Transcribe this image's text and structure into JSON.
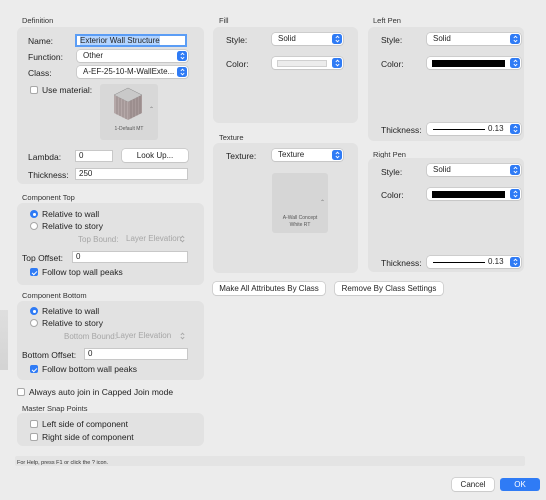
{
  "definition": {
    "title": "Definition",
    "name_label": "Name:",
    "name_value": "Exterior Wall Structure",
    "function_label": "Function:",
    "function_value": "Other",
    "class_label": "Class:",
    "class_value": "A-EF-25-10-M-WallExte...",
    "use_material_label": "Use material:",
    "use_material_checked": false,
    "material_name": "1-Default MT",
    "lambda_label": "Lambda:",
    "lambda_value": "0",
    "lookup_label": "Look Up...",
    "thickness_label": "Thickness:",
    "thickness_value": "250"
  },
  "component_top": {
    "title": "Component Top",
    "relative_wall": "Relative to wall",
    "relative_story": "Relative to story",
    "selected": "Relative to wall",
    "bound_label": "Top Bound:",
    "bound_value": "Layer Elevation",
    "offset_label": "Top Offset:",
    "offset_value": "0",
    "follow_label": "Follow top wall peaks",
    "follow_checked": true
  },
  "component_bottom": {
    "title": "Component Bottom",
    "relative_wall": "Relative to wall",
    "relative_story": "Relative to story",
    "selected": "Relative to wall",
    "bound_label": "Bottom Bound:",
    "bound_value": "Layer Elevation",
    "offset_label": "Bottom Offset:",
    "offset_value": "0",
    "follow_label": "Follow bottom wall peaks",
    "follow_checked": true
  },
  "auto_join": {
    "label": "Always auto join in Capped Join mode",
    "checked": false
  },
  "snap": {
    "title": "Master Snap Points",
    "left_label": "Left side of component",
    "left_checked": false,
    "right_label": "Right side of component",
    "right_checked": false
  },
  "fill": {
    "title": "Fill",
    "style_label": "Style:",
    "style_value": "Solid",
    "color_label": "Color:",
    "color_hex": "#ececec"
  },
  "texture": {
    "title": "Texture",
    "texture_label": "Texture:",
    "texture_value": "Texture",
    "thumb_name_line1": "A-Wall Concept",
    "thumb_name_line2": "White RT"
  },
  "left_pen": {
    "title": "Left Pen",
    "style_label": "Style:",
    "style_value": "Solid",
    "color_label": "Color:",
    "color_hex": "#000000",
    "thickness_label": "Thickness:",
    "thickness_value": "0.13"
  },
  "right_pen": {
    "title": "Right Pen",
    "style_label": "Style:",
    "style_value": "Solid",
    "color_label": "Color:",
    "color_hex": "#000000",
    "thickness_label": "Thickness:",
    "thickness_value": "0.13"
  },
  "actions": {
    "make_all_by_class": "Make All Attributes By Class",
    "remove_by_class": "Remove By Class Settings"
  },
  "status_text": "For Help, press F1 or click the ? icon.",
  "footer": {
    "cancel": "Cancel",
    "ok": "OK"
  },
  "colors": {
    "accent": "#2f7bf5",
    "panel": "#e2e2e2",
    "background": "#ececec"
  }
}
